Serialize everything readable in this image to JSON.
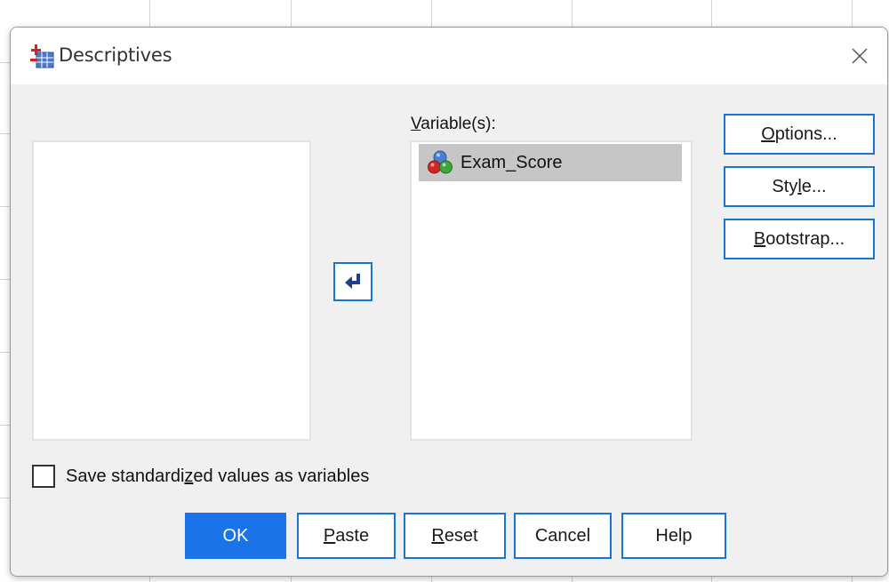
{
  "dialog": {
    "title": "Descriptives",
    "close_label": "close"
  },
  "variables_panel": {
    "label_accel": "V",
    "label_rest": "ariable(s):",
    "items": [
      {
        "name": "Exam_Score",
        "icon": "scale-variable-icon"
      }
    ]
  },
  "source_list": {
    "items": []
  },
  "move_button": {
    "icon": "arrow-left-icon"
  },
  "side_buttons": {
    "options": {
      "pre": "",
      "accel": "O",
      "post": "ptions..."
    },
    "style": {
      "pre": "Sty",
      "accel": "l",
      "post": "e..."
    },
    "bootstrap": {
      "pre": "",
      "accel": "B",
      "post": "ootstrap..."
    }
  },
  "save_standardized": {
    "pre": "Save standardi",
    "accel": "z",
    "post": "ed values as variables",
    "checked": false
  },
  "bottom_buttons": {
    "ok": {
      "pre": "OK",
      "accel": "",
      "post": ""
    },
    "paste": {
      "pre": "",
      "accel": "P",
      "post": "aste"
    },
    "reset": {
      "pre": "",
      "accel": "R",
      "post": "eset"
    },
    "cancel": {
      "pre": "Cancel",
      "accel": "",
      "post": ""
    },
    "help": {
      "pre": "Help",
      "accel": "",
      "post": ""
    }
  },
  "colors": {
    "accent": "#1a73e8",
    "button_border": "#1a73d9",
    "selected_item": "#c6c6c6",
    "dialog_bg": "#f0f0f0"
  }
}
